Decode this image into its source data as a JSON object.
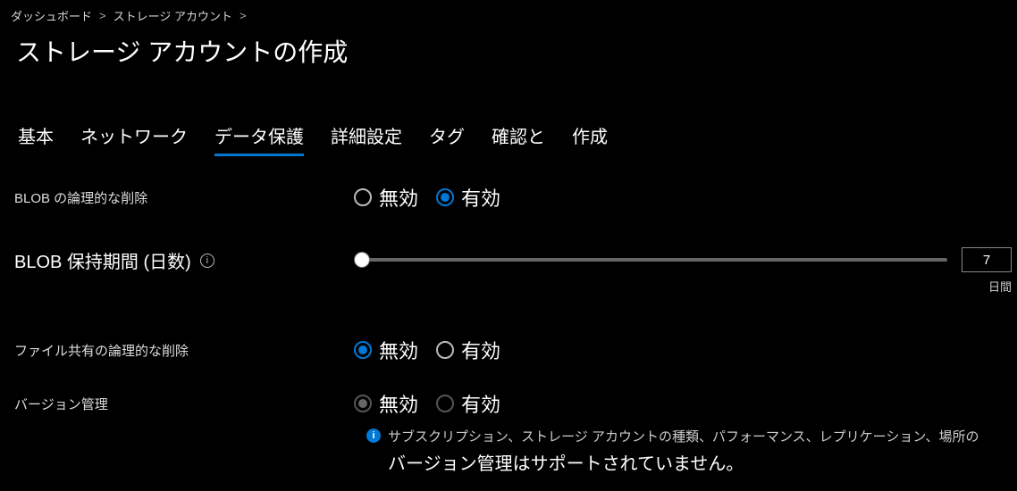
{
  "breadcrumb": {
    "dashboard": "ダッシュボード",
    "storage_accounts": "ストレージ アカウント"
  },
  "page_title": "ストレージ アカウントの作成",
  "tabs": {
    "basic": "基本",
    "network": "ネットワーク",
    "data_protection": "データ保護",
    "advanced": "詳細設定",
    "tags": "タグ",
    "review": "確認と",
    "create": "作成"
  },
  "labels": {
    "blob_soft_delete": "BLOB の論理的な削除",
    "blob_retention": "BLOB 保持期間 (日数)",
    "fileshare_soft_delete": "ファイル共有の論理的な削除",
    "versioning": "バージョン管理"
  },
  "options": {
    "disabled": "無効",
    "enabled": "有効"
  },
  "values": {
    "blob_soft_delete": "enabled",
    "blob_retention_days": "7",
    "retention_unit": "日間",
    "fileshare_soft_delete": "disabled",
    "versioning": "disabled",
    "versioning_locked": true
  },
  "notice": {
    "detail": "サブスクリプション、ストレージ アカウントの種類、パフォーマンス、レプリケーション、場所の",
    "main": "バージョン管理はサポートされていません。"
  }
}
